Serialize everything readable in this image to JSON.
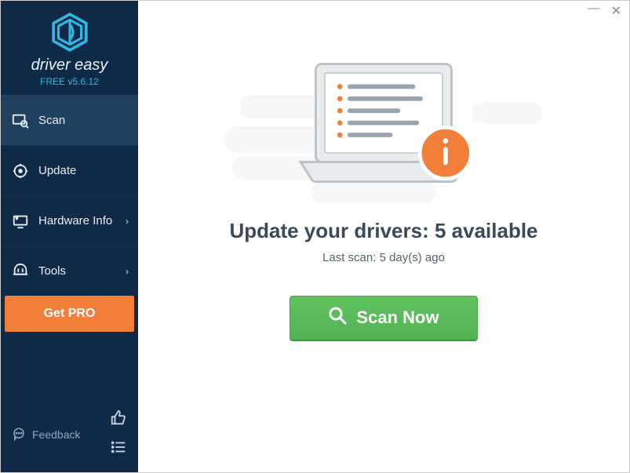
{
  "brand": {
    "name": "driver easy",
    "version": "FREE v5.6.12"
  },
  "nav": {
    "scan": {
      "label": "Scan"
    },
    "update": {
      "label": "Update"
    },
    "hardware": {
      "label": "Hardware Info"
    },
    "tools": {
      "label": "Tools"
    }
  },
  "getpro": {
    "label": "Get PRO"
  },
  "feedback": {
    "label": "Feedback"
  },
  "main": {
    "headline": "Update your drivers: 5 available",
    "subline": "Last scan: 5 day(s) ago",
    "scan_label": "Scan Now"
  },
  "colors": {
    "accent_orange": "#f17f3a",
    "accent_green": "#54b454",
    "sidebar_bg": "#0e2a47",
    "logo_blue": "#2fb8e6"
  }
}
